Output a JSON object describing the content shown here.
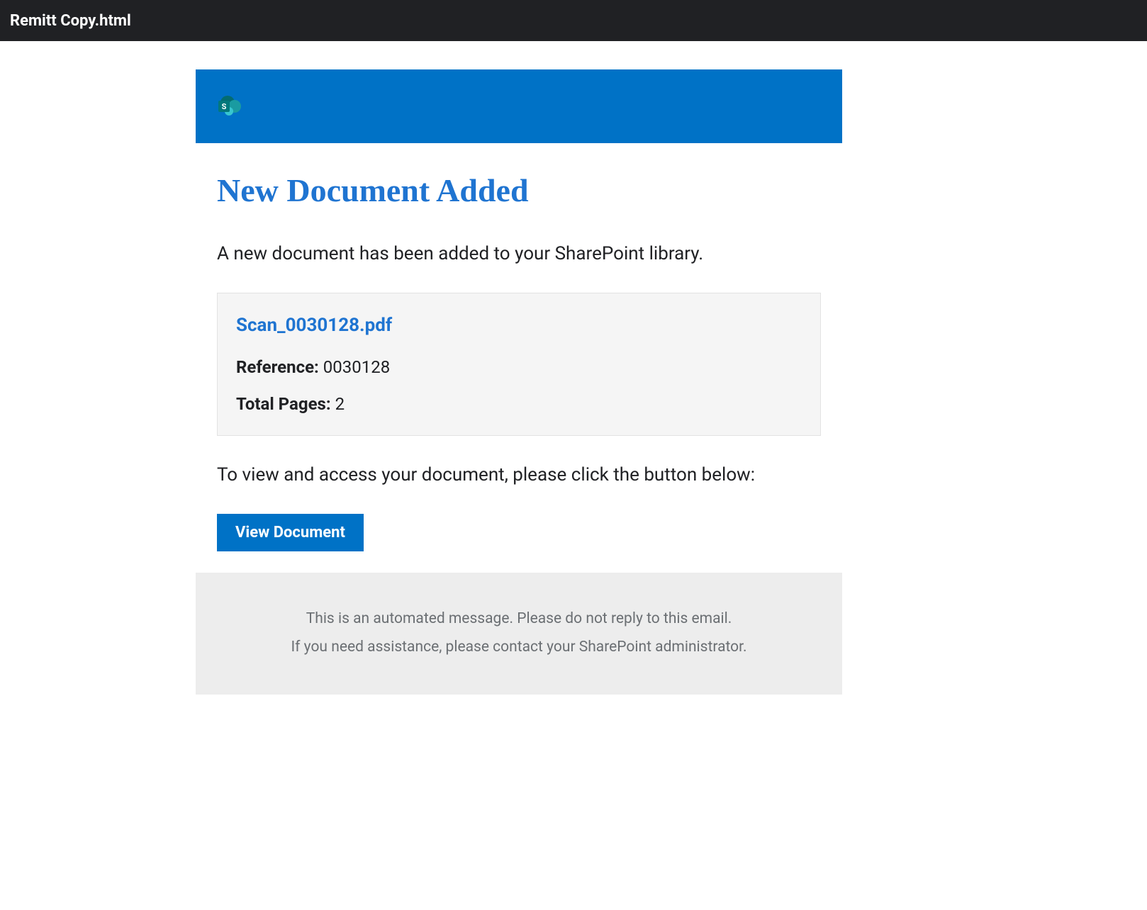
{
  "window": {
    "title": "Remitt Copy.html"
  },
  "banner": {
    "icon_letter": "S"
  },
  "email": {
    "heading": "New Document Added",
    "intro": "A new document has been added to your SharePoint library.",
    "document": {
      "filename": "Scan_0030128.pdf",
      "reference_label": "Reference:",
      "reference_value": "0030128",
      "pages_label": "Total Pages:",
      "pages_value": "2"
    },
    "instruction": "To view and access your document, please click the button below:",
    "button_label": "View Document"
  },
  "footer": {
    "line1": "This is an automated message. Please do not reply to this email.",
    "line2": "If you need assistance, please contact your SharePoint administrator."
  }
}
